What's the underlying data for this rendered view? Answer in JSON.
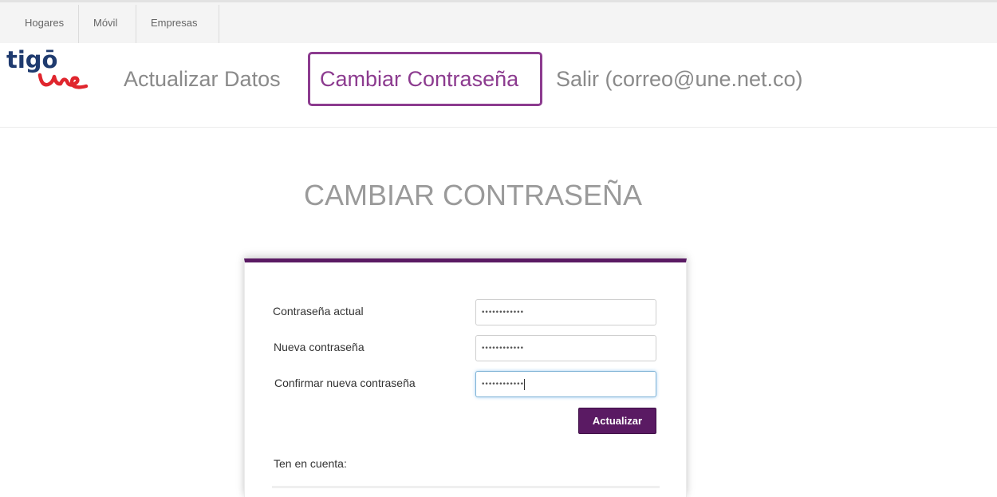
{
  "segments": {
    "hogares": "Hogares",
    "movil": "Móvil",
    "empresas": "Empresas"
  },
  "logo": {
    "tigo": "tigō",
    "une": "une",
    "colors": {
      "tigo": "#1f3b6f",
      "une": "#e0262e"
    }
  },
  "nav": {
    "actualizar": "Actualizar Datos",
    "cambiar": "Cambiar Contraseña",
    "salir": "Salir (correo@une.net.co)"
  },
  "title": "CAMBIAR CONTRASEÑA",
  "form": {
    "actual_label": "Contraseña actual",
    "actual_value": "••••••••••••",
    "nueva_label": "Nueva contraseña",
    "nueva_value": "••••••••••••",
    "confirmar_label": "Confirmar nueva contraseña",
    "confirmar_value": "••••••••••••",
    "submit_label": "Actualizar"
  },
  "note": "Ten en cuenta:",
  "colors": {
    "accent": "#8c3b8f",
    "primary": "#5a1a63",
    "muted_text": "#8a8a8a"
  }
}
